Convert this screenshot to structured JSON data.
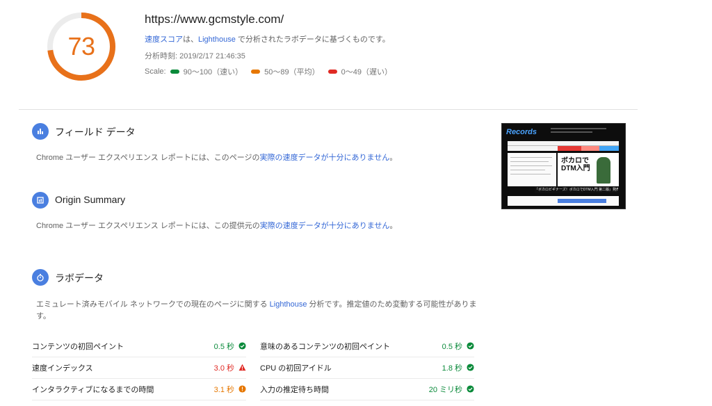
{
  "header": {
    "score": "73",
    "score_color": "#e8711a",
    "score_fraction": 0.73,
    "url": "https://www.gcmstyle.com/",
    "desc_link1": "速度スコア",
    "desc_part1": "は、",
    "desc_link2": "Lighthouse",
    "desc_part2": " で分析されたラボデータに基づくものです。",
    "time_label": "分析時刻: 2019/2/17 21:46:35",
    "scale_label": "Scale:",
    "scale_good": "90〜100（速い）",
    "scale_avg": "50〜89（平均）",
    "scale_bad": "0〜49（遅い）",
    "colors": {
      "good": "#0a8a3a",
      "avg": "#e67700",
      "bad": "#e02a24",
      "accent": "#4a7fe0"
    }
  },
  "field": {
    "title": "フィールド データ",
    "icon": "bar-chart-icon",
    "text_part1": "Chrome ユーザー エクスペリエンス レポートには、このページの",
    "text_link": "実際の速度データが十分にありません",
    "text_part2": "。"
  },
  "origin": {
    "title": "Origin Summary",
    "icon": "summary-icon",
    "text_part1": "Chrome ユーザー エクスペリエンス レポートには、この提供元の",
    "text_link": "実際の速度データが十分にありません",
    "text_part2": "。"
  },
  "lab": {
    "title": "ラボデータ",
    "icon": "stopwatch-icon",
    "text_part1": "エミュレート済みモバイル ネットワークでの現在のページに関する ",
    "text_link": "Lighthouse",
    "text_part2": " 分析です。推定値のため変動する可能性がありま",
    "text_part3": "す。"
  },
  "thumbnail": {
    "logo": "Records",
    "banner": "ボカロでDTM入門",
    "caption": "『ボカロビギナーズ！ボカロでDTM入門 第二版』発売！"
  },
  "metrics": {
    "left": [
      {
        "label": "コンテンツの初回ペイント",
        "value": "0.5 秒",
        "status": "good"
      },
      {
        "label": "速度インデックス",
        "value": "3.0 秒",
        "status": "bad"
      },
      {
        "label": "インタラクティブになるまでの時間",
        "value": "3.1 秒",
        "status": "avg"
      }
    ],
    "right": [
      {
        "label": "意味のあるコンテンツの初回ペイント",
        "value": "0.5 秒",
        "status": "good"
      },
      {
        "label": "CPU の初回アイドル",
        "value": "1.8 秒",
        "status": "good"
      },
      {
        "label": "入力の推定待ち時間",
        "value": "20 ミリ秒",
        "status": "good"
      }
    ]
  }
}
